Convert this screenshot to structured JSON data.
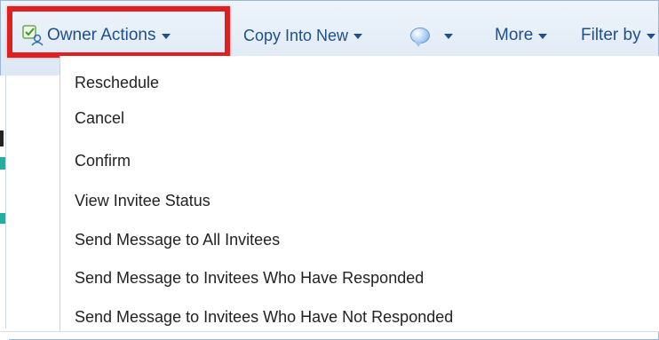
{
  "toolbar": {
    "owner_actions_label": "Owner Actions",
    "copy_into_new_label": "Copy Into New",
    "more_label": "More",
    "filter_label": "Filter by"
  },
  "menu": {
    "items": [
      {
        "label": "Reschedule"
      },
      {
        "label": "Cancel"
      },
      {
        "label": "Confirm"
      },
      {
        "label": "View Invitee Status"
      },
      {
        "label": "Send Message to All Invitees"
      },
      {
        "label": "Send Message to Invitees Who Have Responded"
      },
      {
        "label": "Send Message to Invitees Who Have Not Responded"
      }
    ]
  },
  "icons": {
    "owner_actions": "owner-check-person-icon",
    "chat": "chat-bubble-icon",
    "dropdown": "caret-down-icon"
  },
  "colors": {
    "toolbar_text": "#1d4f91",
    "highlight": "#e02020",
    "menu_text": "#222222"
  }
}
